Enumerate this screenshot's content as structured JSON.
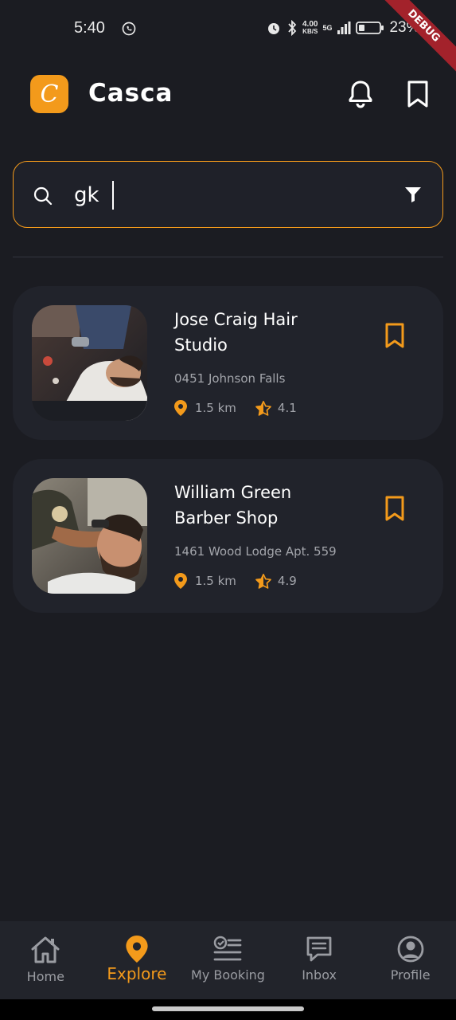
{
  "status_bar": {
    "time": "5:40",
    "speed_value": "4.00",
    "speed_unit": "KB/S",
    "network": "5G",
    "battery": "23%",
    "debug_label": "DEBUG"
  },
  "header": {
    "logo_letter": "C",
    "title": "Casca"
  },
  "search": {
    "value": "gk",
    "placeholder": ""
  },
  "results": [
    {
      "name": "Jose Craig Hair Studio",
      "address": "0451 Johnson Falls",
      "distance": "1.5 km",
      "rating": "4.1"
    },
    {
      "name": "William Green Barber Shop",
      "address": "1461 Wood Lodge Apt. 559",
      "distance": "1.5 km",
      "rating": "4.9"
    }
  ],
  "nav": {
    "home": "Home",
    "explore": "Explore",
    "booking": "My Booking",
    "inbox": "Inbox",
    "profile": "Profile"
  },
  "colors": {
    "accent": "#f39a1b",
    "background": "#1b1c22",
    "card": "#21232b"
  }
}
